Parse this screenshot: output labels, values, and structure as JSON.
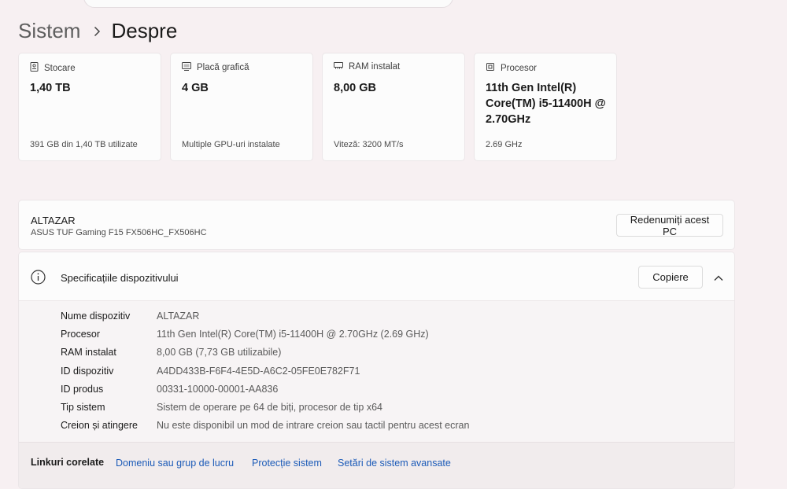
{
  "breadcrumb": {
    "parent": "Sistem",
    "current": "Despre"
  },
  "cards": [
    {
      "icon": "storage-icon",
      "title": "Stocare",
      "value": "1,40 TB",
      "sub": "391 GB din 1,40 TB utilizate"
    },
    {
      "icon": "graphics-card-icon",
      "title": "Placă grafică",
      "value": "4 GB",
      "sub": "Multiple GPU-uri instalate"
    },
    {
      "icon": "ram-icon",
      "title": "RAM instalat",
      "value": "8,00 GB",
      "sub": "Viteză: 3200 MT/s"
    },
    {
      "icon": "processor-icon",
      "title": "Procesor",
      "value": "11th Gen Intel(R) Core(TM) i5-11400H @ 2.70GHz",
      "sub": "2.69 GHz"
    }
  ],
  "pc": {
    "name": "ALTAZAR",
    "model": "ASUS TUF Gaming F15 FX506HC_FX506HC",
    "rename_label": "Redenumiți acest PC"
  },
  "specs": {
    "title": "Specificațiile dispozitivului",
    "copy_label": "Copiere",
    "rows": [
      {
        "label": "Nume dispozitiv",
        "value": "ALTAZAR"
      },
      {
        "label": "Procesor",
        "value": "11th Gen Intel(R) Core(TM) i5-11400H @ 2.70GHz (2.69 GHz)"
      },
      {
        "label": "RAM instalat",
        "value": "8,00 GB (7,73 GB utilizabile)"
      },
      {
        "label": "ID dispozitiv",
        "value": "A4DD433B-F6F4-4E5D-A6C2-05FE0E782F71"
      },
      {
        "label": "ID produs",
        "value": "00331-10000-00001-AA836"
      },
      {
        "label": "Tip sistem",
        "value": "Sistem de operare pe 64 de biți, procesor de tip x64"
      },
      {
        "label": "Creion și atingere",
        "value": "Nu este disponibil un mod de intrare creion sau tactil pentru acest ecran"
      }
    ]
  },
  "related": {
    "label": "Linkuri corelate",
    "links": [
      "Domeniu sau grup de lucru",
      "Protecție sistem",
      "Setări de sistem avansate"
    ]
  },
  "colors": {
    "background": "#f7f0f2",
    "card": "#fcfcfc",
    "link": "#1c5bb8"
  }
}
